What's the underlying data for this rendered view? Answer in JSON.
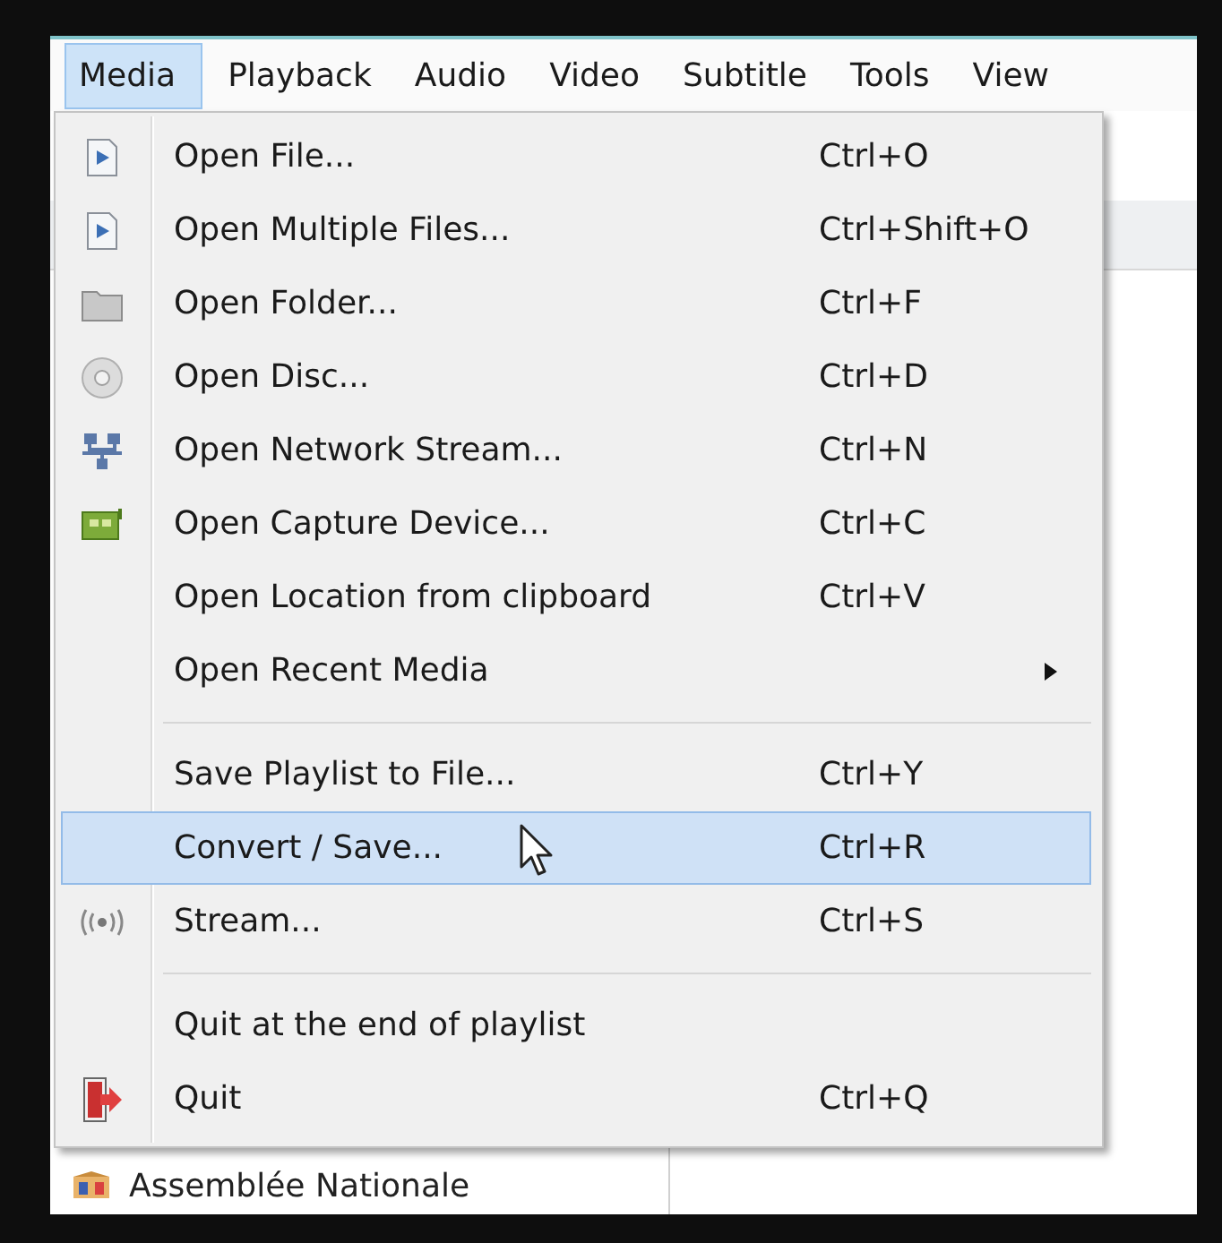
{
  "menubar": [
    {
      "label": "Media",
      "selected": true
    },
    {
      "label": "Playback",
      "selected": false
    },
    {
      "label": "Audio",
      "selected": false
    },
    {
      "label": "Video",
      "selected": false
    },
    {
      "label": "Subtitle",
      "selected": false
    },
    {
      "label": "Tools",
      "selected": false
    },
    {
      "label": "View",
      "selected": false
    }
  ],
  "menu": [
    {
      "kind": "item",
      "label": "Open File...",
      "shortcut": "Ctrl+O",
      "selected": false
    },
    {
      "kind": "item",
      "label": "Open Multiple Files...",
      "shortcut": "Ctrl+Shift+O",
      "selected": false
    },
    {
      "kind": "item",
      "label": "Open Folder...",
      "shortcut": "Ctrl+F",
      "selected": false
    },
    {
      "kind": "item",
      "label": "Open Disc...",
      "shortcut": "Ctrl+D",
      "selected": false
    },
    {
      "kind": "item",
      "label": "Open Network Stream...",
      "shortcut": "Ctrl+N",
      "selected": false
    },
    {
      "kind": "item",
      "label": "Open Capture Device...",
      "shortcut": "Ctrl+C",
      "selected": false
    },
    {
      "kind": "item",
      "label": "Open Location from clipboard",
      "shortcut": "Ctrl+V",
      "selected": false
    },
    {
      "kind": "item",
      "label": "Open Recent Media",
      "has_submenu": true,
      "selected": false
    },
    {
      "kind": "separator"
    },
    {
      "kind": "item",
      "label": "Save Playlist to File...",
      "shortcut": "Ctrl+Y",
      "selected": false
    },
    {
      "kind": "item",
      "label": "Convert / Save...",
      "shortcut": "Ctrl+R",
      "selected": true
    },
    {
      "kind": "item",
      "label": "Stream...",
      "shortcut": "Ctrl+S",
      "selected": false
    },
    {
      "kind": "separator"
    },
    {
      "kind": "item",
      "label": "Quit at the end of playlist",
      "selected": false
    },
    {
      "kind": "item",
      "label": "Quit",
      "shortcut": "Ctrl+Q",
      "selected": false
    }
  ],
  "sidebar": {
    "items": [
      {
        "label": "Assemblée Nationale"
      }
    ]
  }
}
